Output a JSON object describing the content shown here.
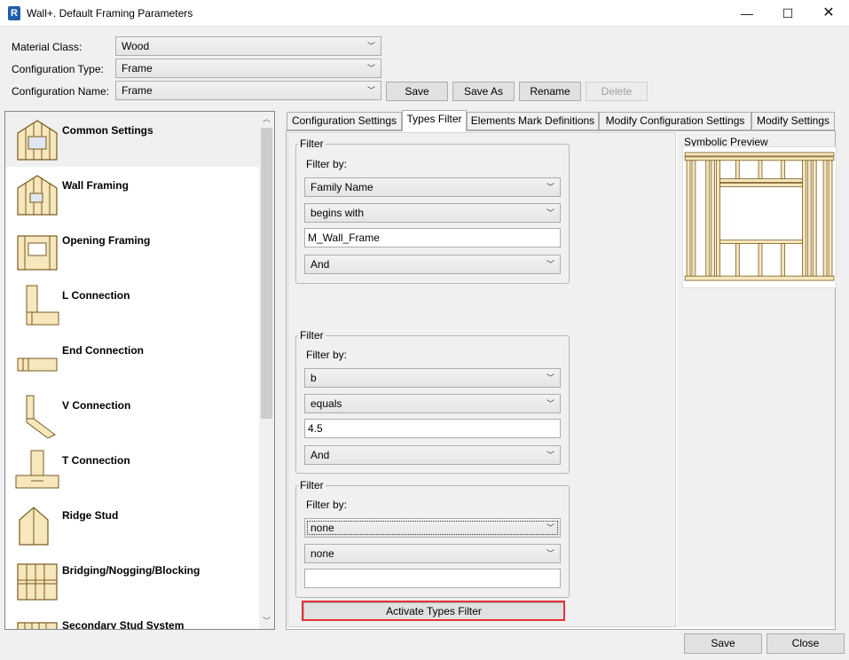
{
  "window": {
    "app_icon_letter": "R",
    "title": "Wall+. Default Framing Parameters",
    "minimize": "—",
    "maximize": "☐",
    "close": "✕"
  },
  "config": {
    "material_class_label": "Material Class:",
    "material_class_value": "Wood",
    "configuration_type_label": "Configuration Type:",
    "configuration_type_value": "Frame",
    "configuration_name_label": "Configuration Name:",
    "configuration_name_value": "Frame",
    "save_label": "Save",
    "save_as_label": "Save As",
    "rename_label": "Rename",
    "delete_label": "Delete"
  },
  "sidebar": {
    "items": [
      {
        "label": "Common Settings"
      },
      {
        "label": "Wall Framing"
      },
      {
        "label": "Opening Framing"
      },
      {
        "label": "L Connection"
      },
      {
        "label": "End Connection"
      },
      {
        "label": "V Connection"
      },
      {
        "label": "T Connection"
      },
      {
        "label": "Ridge Stud"
      },
      {
        "label": "Bridging/Nogging/Blocking"
      },
      {
        "label": "Secondary Stud System"
      }
    ]
  },
  "tabs": [
    {
      "label": "Configuration Settings"
    },
    {
      "label": "Types Filter"
    },
    {
      "label": "Elements Mark Definitions"
    },
    {
      "label": "Modify Configuration Settings"
    },
    {
      "label": "Modify Settings"
    }
  ],
  "types_filter": {
    "outer_title": "Filter",
    "filters": [
      {
        "title": "Filter",
        "filter_by_label": "Filter by:",
        "parameter": "Family Name",
        "condition": "begins with",
        "value": "M_Wall_Frame",
        "logic": "And"
      },
      {
        "title": "Filter",
        "filter_by_label": "Filter by:",
        "parameter": "b",
        "condition": "equals",
        "value": "4.5",
        "logic": "And"
      },
      {
        "title": "Filter",
        "filter_by_label": "Filter by:",
        "parameter": "none",
        "condition": "none",
        "value": ""
      }
    ],
    "activate_label": "Activate Types Filter"
  },
  "preview": {
    "title": "Symbolic Preview"
  },
  "footer": {
    "save_label": "Save",
    "close_label": "Close"
  }
}
